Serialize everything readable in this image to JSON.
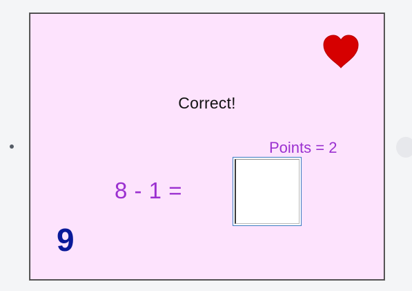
{
  "feedback": {
    "text": "Correct!"
  },
  "points": {
    "text": "Points = 2"
  },
  "question": {
    "text": "8 - 1 ="
  },
  "answer": {
    "value": ""
  },
  "score": {
    "value": "9"
  },
  "lives_icon": "heart-icon",
  "colors": {
    "panel_background": "#fde3fd",
    "heart": "#d60000",
    "question_text": "#9b30d0",
    "score_text": "#0a1a99"
  }
}
